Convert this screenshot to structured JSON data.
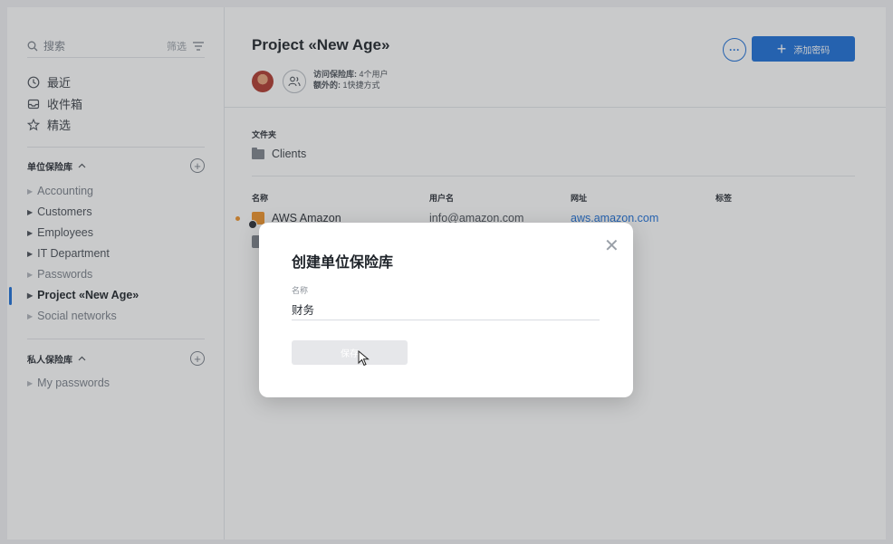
{
  "sidebar": {
    "search_label": "搜索",
    "filter_label": "筛选",
    "nav": {
      "recent": "最近",
      "inbox": "收件箱",
      "favorites": "精选"
    },
    "shared_vaults": {
      "heading": "单位保险库",
      "items": [
        "Accounting",
        "Customers",
        "Employees",
        "IT Department",
        "Passwords",
        "Project «New Age»",
        "Social networks"
      ]
    },
    "private_vaults": {
      "heading": "私人保险库",
      "items": [
        "My passwords"
      ]
    }
  },
  "main": {
    "title": "Project «New Age»",
    "access_line_label": "访问保险库:",
    "access_line_value": "4个用户",
    "extra_line_label": "额外的:",
    "extra_line_value": "1快捷方式",
    "add_button": "添加密码",
    "folders_heading": "文件夹",
    "folder": "Clients",
    "columns": [
      "名称",
      "用户名",
      "网址",
      "标签"
    ],
    "rows": [
      {
        "name": "AWS Amazon",
        "username": "info@amazon.com",
        "url": "aws.amazon.com"
      }
    ]
  },
  "modal": {
    "title": "创建单位保险库",
    "field_label": "名称",
    "field_value": "财务",
    "save_button": "保存"
  },
  "colors": {
    "accent": "#1d6fd8",
    "aws_orange": "#f0932a"
  }
}
